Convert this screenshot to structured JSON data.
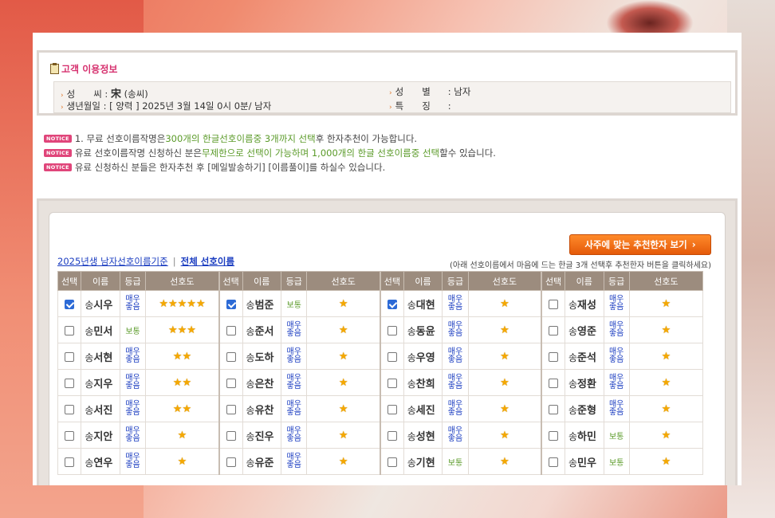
{
  "customer": {
    "title": "고객 이용정보",
    "surname_label": "성　　씨",
    "surname_hanja": "宋",
    "surname_hangul": "(송씨)",
    "gender_label": "성　　별",
    "gender_value": ": 남자",
    "birth_label": "생년월일",
    "birth_value": ": [ 양력 ] 2025년 3월 14일 0시 0분/ 남자",
    "special_label": "특　　징",
    "special_value": ":"
  },
  "notices": [
    {
      "badge": "NOTICE",
      "parts": [
        {
          "t": "1. 무료 선호이름작명은 ",
          "c": ""
        },
        {
          "t": "300개의 한글선호이름중 3개까지 선택",
          "c": "green"
        },
        {
          "t": "후 한자추천이 가능합니다.",
          "c": ""
        }
      ]
    },
    {
      "badge": "NOTICE",
      "parts": [
        {
          "t": "유료 선호이름작명 신청하신 분은",
          "c": ""
        },
        {
          "t": "무제한으로 선택이 가능하며 1,000개의 한글 선호이름중 선택",
          "c": "green"
        },
        {
          "t": "할수 있습니다.",
          "c": ""
        }
      ]
    },
    {
      "badge": "NOTICE",
      "parts": [
        {
          "t": "유료 신청하신 분들은 한자추천 후 [메일발송하기] [이름풀이]를 하실수 있습니다.",
          "c": ""
        }
      ]
    }
  ],
  "toolbar": {
    "recommend_button": "사주에 맞는 추천한자 보기",
    "link_year": "2025년생 남자선호이름기준",
    "link_sep": "|",
    "link_all": "전체 선호이름",
    "hint": "(아래 선호이름에서 마음에 드는 한글 3개 선택후 추천한자 버튼을 클릭하세요)"
  },
  "table": {
    "headers": [
      "선택",
      "이름",
      "등급",
      "선호도"
    ],
    "surname": "송",
    "grade_labels": {
      "high": "매우좋음",
      "mid": "보통"
    },
    "rows": [
      [
        {
          "n": "시우",
          "g": "high",
          "s": 5,
          "c": true
        },
        {
          "n": "범준",
          "g": "mid",
          "s": 1,
          "c": true
        },
        {
          "n": "대현",
          "g": "high",
          "s": 1,
          "c": true
        },
        {
          "n": "재성",
          "g": "high",
          "s": 1,
          "c": false
        }
      ],
      [
        {
          "n": "민서",
          "g": "mid",
          "s": 3,
          "c": false
        },
        {
          "n": "준서",
          "g": "high",
          "s": 1,
          "c": false
        },
        {
          "n": "동윤",
          "g": "high",
          "s": 1,
          "c": false
        },
        {
          "n": "영준",
          "g": "high",
          "s": 1,
          "c": false
        }
      ],
      [
        {
          "n": "서현",
          "g": "high",
          "s": 2,
          "c": false
        },
        {
          "n": "도하",
          "g": "high",
          "s": 1,
          "c": false
        },
        {
          "n": "우영",
          "g": "high",
          "s": 1,
          "c": false
        },
        {
          "n": "준석",
          "g": "high",
          "s": 1,
          "c": false
        }
      ],
      [
        {
          "n": "지우",
          "g": "high",
          "s": 2,
          "c": false
        },
        {
          "n": "은찬",
          "g": "high",
          "s": 1,
          "c": false
        },
        {
          "n": "찬희",
          "g": "high",
          "s": 1,
          "c": false
        },
        {
          "n": "정환",
          "g": "high",
          "s": 1,
          "c": false
        }
      ],
      [
        {
          "n": "서진",
          "g": "high",
          "s": 2,
          "c": false
        },
        {
          "n": "유찬",
          "g": "high",
          "s": 1,
          "c": false
        },
        {
          "n": "세진",
          "g": "high",
          "s": 1,
          "c": false
        },
        {
          "n": "준형",
          "g": "high",
          "s": 1,
          "c": false
        }
      ],
      [
        {
          "n": "지안",
          "g": "high",
          "s": 1,
          "c": false
        },
        {
          "n": "진우",
          "g": "high",
          "s": 1,
          "c": false
        },
        {
          "n": "성현",
          "g": "high",
          "s": 1,
          "c": false
        },
        {
          "n": "하민",
          "g": "mid",
          "s": 1,
          "c": false
        }
      ],
      [
        {
          "n": "연우",
          "g": "high",
          "s": 1,
          "c": false
        },
        {
          "n": "유준",
          "g": "high",
          "s": 1,
          "c": false
        },
        {
          "n": "기현",
          "g": "mid",
          "s": 1,
          "c": false
        },
        {
          "n": "민우",
          "g": "mid",
          "s": 1,
          "c": false
        }
      ]
    ]
  }
}
